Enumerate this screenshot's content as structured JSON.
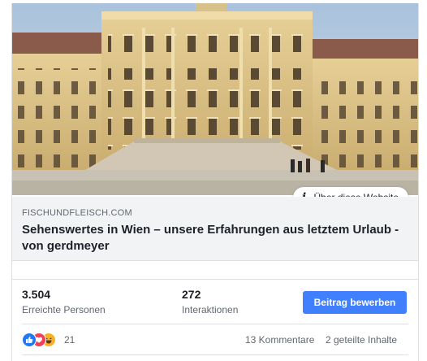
{
  "link_preview": {
    "image_alt": "Schönbrunn Palace facade in Vienna",
    "about_button_label": "Über diese Website",
    "domain": "FISCHUNDFLEISCH.COM",
    "headline": "Sehenswertes in Wien – unsere Erfahrungen aus letztem Urlaub - von gerdmeyer"
  },
  "insights": {
    "reach_value": "3.504",
    "reach_label": "Erreichte Personen",
    "engagement_value": "272",
    "engagement_label": "Interaktionen",
    "promote_label": "Beitrag bewerben"
  },
  "reactions": {
    "icons": [
      "like-icon",
      "love-icon",
      "haha-icon"
    ],
    "count": "21",
    "comments": "13 Kommentare",
    "shares": "2 geteilte Inhalte"
  },
  "colors": {
    "accent": "#4080ff",
    "like": "#2078f4",
    "love": "#f33e58",
    "haha": "#f7b125"
  }
}
